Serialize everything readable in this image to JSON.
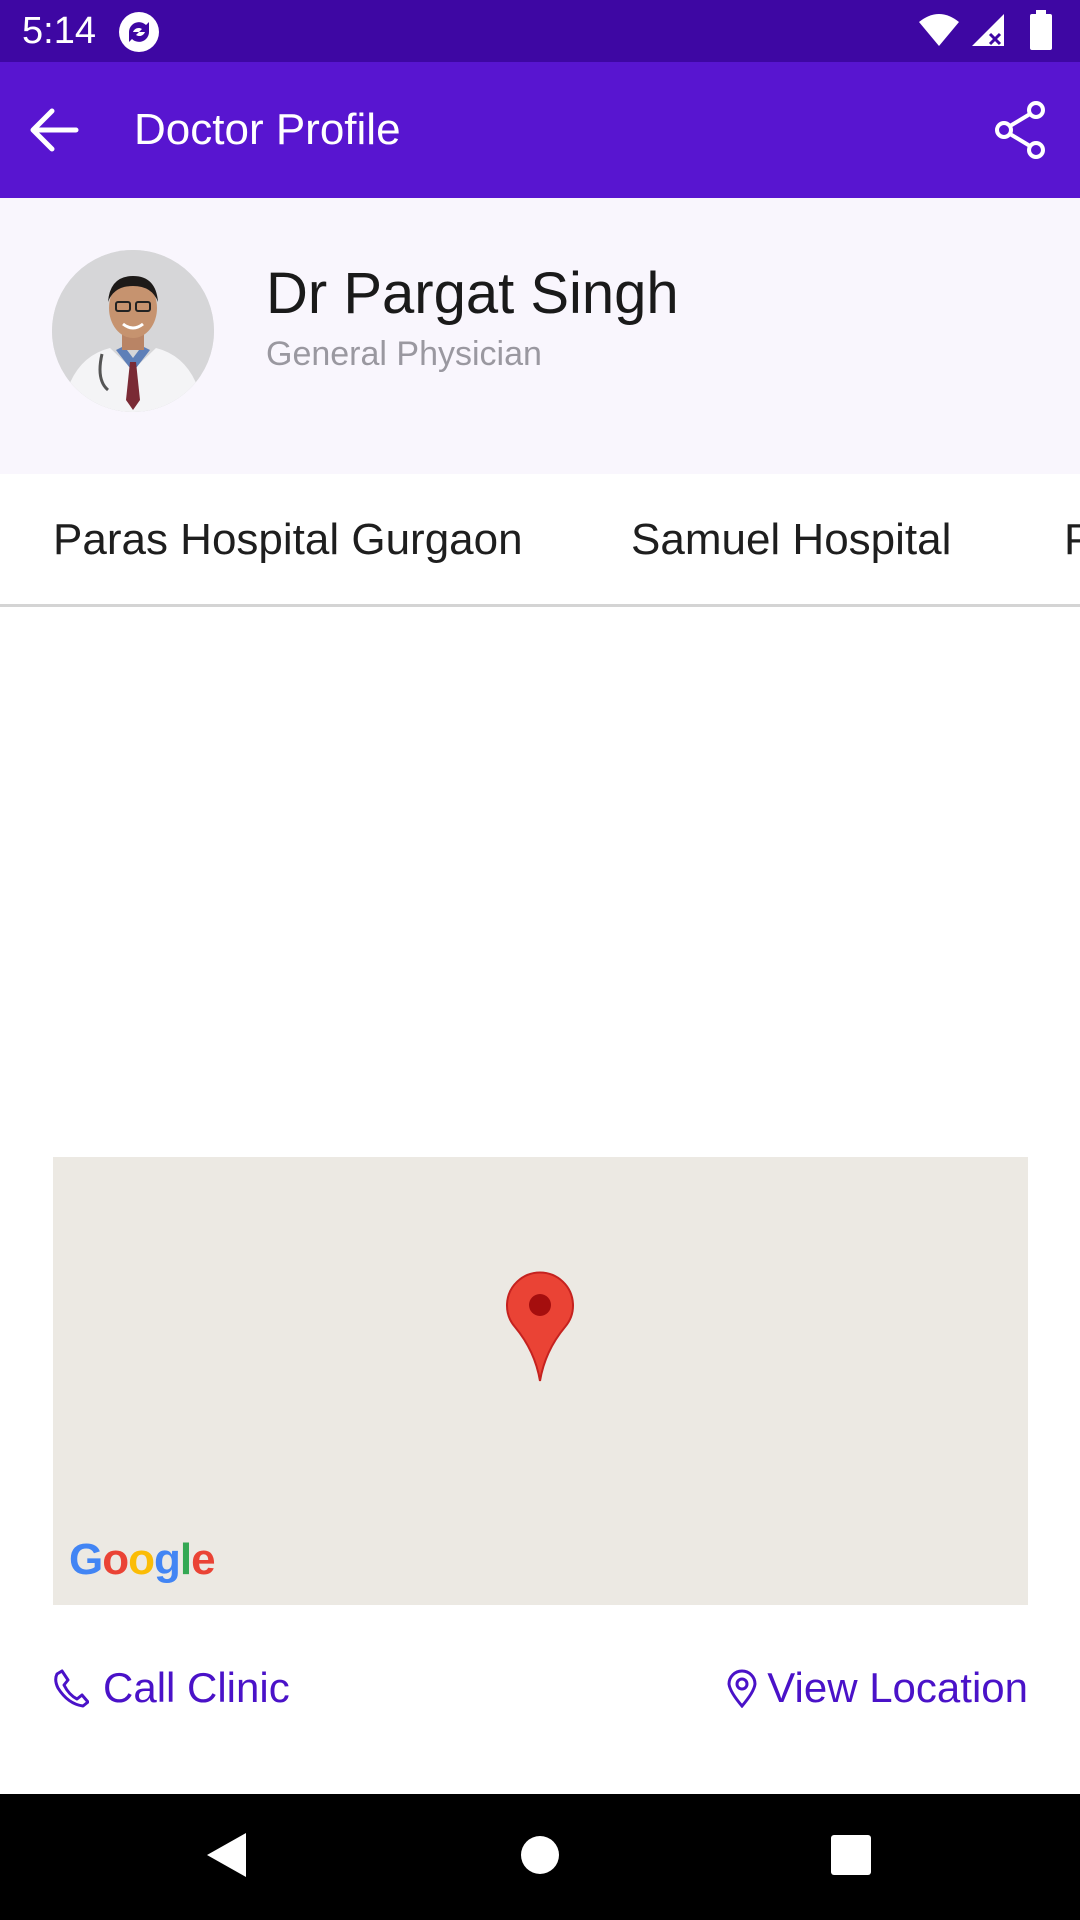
{
  "status_bar": {
    "time": "5:14",
    "app_icon": "sync-app-icon",
    "icons": [
      "wifi-icon",
      "signal-icon",
      "battery-icon"
    ]
  },
  "app_bar": {
    "title": "Doctor Profile",
    "back_icon": "arrow-left-icon",
    "share_icon": "share-icon"
  },
  "profile": {
    "name": "Dr Pargat Singh",
    "specialty": "General Physician"
  },
  "clinic_tabs": [
    "Paras Hospital Gurgaon",
    "Samuel Hospital",
    "P"
  ],
  "map": {
    "attribution": "Google",
    "marker_icon": "map-pin-icon"
  },
  "actions": {
    "call_label": "Call Clinic",
    "call_icon": "phone-icon",
    "location_label": "View Location",
    "location_icon": "location-pin-icon"
  },
  "nav_bar": {
    "icons": [
      "back-triangle-icon",
      "home-circle-icon",
      "recents-square-icon"
    ]
  },
  "colors": {
    "status_bar": "#3e07a3",
    "app_bar": "#5815d0",
    "accent": "#4a12c8",
    "profile_bg": "#f9f6fd",
    "map_bg": "#ece9e3",
    "pin": "#ea4335"
  }
}
